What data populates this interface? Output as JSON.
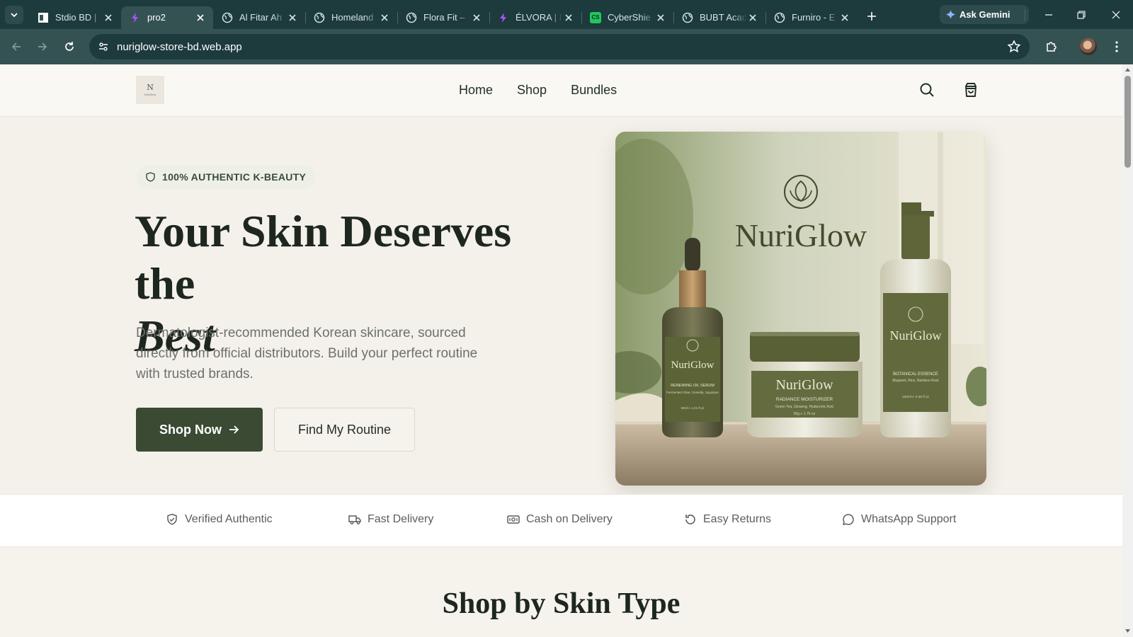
{
  "browser": {
    "tabs": [
      {
        "title": "Stdio BD |",
        "favicon": "page-favicon",
        "active": false
      },
      {
        "title": "pro2",
        "favicon": "bolt-favicon",
        "active": true
      },
      {
        "title": "Al Fitar Ah",
        "favicon": "globe-favicon",
        "active": false
      },
      {
        "title": "Homeland",
        "favicon": "globe-favicon",
        "active": false
      },
      {
        "title": "Flora Fit –",
        "favicon": "globe-favicon",
        "active": false
      },
      {
        "title": "ÉLVORA | I",
        "favicon": "bolt-favicon",
        "active": false
      },
      {
        "title": "CyberShie",
        "favicon": "cs-favicon",
        "active": false
      },
      {
        "title": "BUBT Acad",
        "favicon": "globe-favicon",
        "active": false
      },
      {
        "title": "Furniro - E",
        "favicon": "globe-favicon",
        "active": false
      }
    ],
    "ask_gemini": "Ask Gemini",
    "url": "nuriglow-store-bd.web.app",
    "cs_favicon_text": "CS"
  },
  "site": {
    "logo_text": "N",
    "logo_small": "NuriGlow",
    "nav": [
      "Home",
      "Shop",
      "Bundles"
    ]
  },
  "hero": {
    "badge": "100% AUTHENTIC K-BEAUTY",
    "headline_line1": "Your Skin Deserves the",
    "headline_line2": "Best",
    "lead": "Dermatologist-recommended Korean skincare, sourced directly from official distributors. Build your perfect routine with trusted brands.",
    "primary_cta": "Shop Now",
    "secondary_cta": "Find My Routine",
    "image": {
      "brand": "NuriGlow",
      "serum": {
        "brand": "NuriGlow",
        "name": "RENEWING OIL SERUM",
        "desc": "Fermented Olive, Centella, Squalane",
        "size": "30ml ℮ 1.01 fl oz"
      },
      "cream": {
        "brand": "NuriGlow",
        "name": "RADIANCE MOISTURIZER",
        "desc": "Green Tea, Ginseng, Hyaluronic Acid",
        "size": "50g ℮ 1.76 oz"
      },
      "essence": {
        "brand": "NuriGlow",
        "name": "BOTANICAL ESSENCE",
        "desc": "Mugwort, Rice, Bamboo Root",
        "size": "100ml ℮ 3.38 fl oz"
      }
    }
  },
  "trust": [
    {
      "label": "Verified Authentic",
      "icon": "shield-check-icon"
    },
    {
      "label": "Fast Delivery",
      "icon": "truck-icon"
    },
    {
      "label": "Cash on Delivery",
      "icon": "banknote-icon"
    },
    {
      "label": "Easy Returns",
      "icon": "rotate-icon"
    },
    {
      "label": "WhatsApp Support",
      "icon": "chat-icon"
    }
  ],
  "section": {
    "title": "Shop by Skin Type"
  },
  "colors": {
    "chrome_dark": "#1d3a3c",
    "chrome": "#355253",
    "brand_green": "#3a4a33",
    "page_bg": "#f4f1ea"
  }
}
